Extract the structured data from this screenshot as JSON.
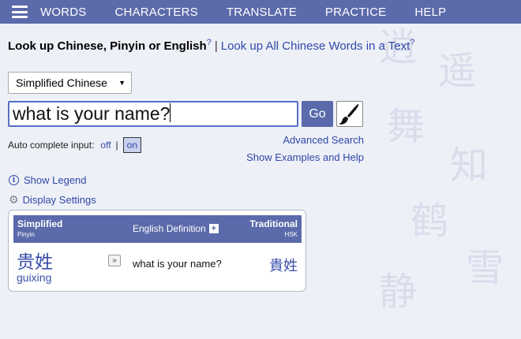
{
  "nav": {
    "items": [
      "WORDS",
      "CHARACTERS",
      "TRANSLATE",
      "PRACTICE",
      "HELP"
    ]
  },
  "lookup": {
    "title": "Look up Chinese, Pinyin or English",
    "help_mark": "?",
    "separator": "|",
    "text_link": "Look up All Chinese Words in a Text",
    "text_help_mark": "?"
  },
  "search": {
    "script_select": "Simplified Chinese",
    "query": "what is your name?",
    "go_label": "Go"
  },
  "autocomplete": {
    "label": "Auto complete input:",
    "off_label": "off",
    "separator": "|",
    "on_label": "on"
  },
  "links": {
    "advanced_search": "Advanced Search",
    "show_examples": "Show Examples and Help",
    "show_legend": "Show Legend",
    "display_settings": "Display Settings"
  },
  "results": {
    "header": {
      "simplified": "Simplified",
      "pinyin": "Pinyin",
      "english": "English Definition",
      "traditional": "Traditional",
      "hsk": "HSK"
    },
    "rows": [
      {
        "simplified": "贵姓",
        "pinyin": "guixing",
        "definition": "what is your name?",
        "traditional": "貴姓"
      }
    ]
  },
  "colors": {
    "nav_bg": "#5a6aaa",
    "link": "#2f48a8",
    "page_bg": "#eef0f7"
  },
  "icons": {
    "menu": "hamburger-menu-icon",
    "brush": "brush-icon",
    "info": "info-icon",
    "gear": "gear-icon",
    "expand": "double-chevron-right-icon",
    "plus": "plus-icon"
  }
}
